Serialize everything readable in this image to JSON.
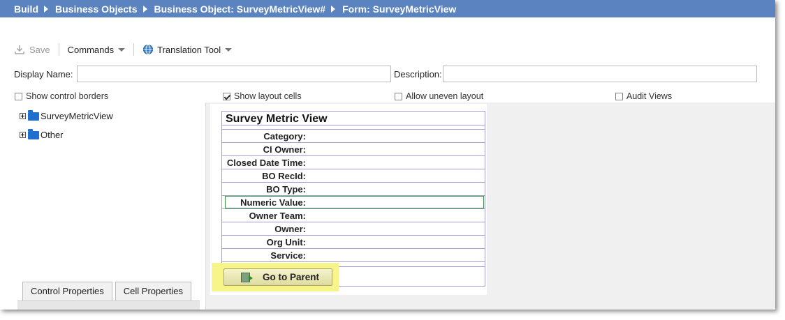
{
  "breadcrumb": [
    "Build",
    "Business Objects",
    "Business Object: SurveyMetricView#",
    "Form: SurveyMetricView"
  ],
  "toolbar": {
    "save_label": "Save",
    "commands_label": "Commands",
    "translation_label": "Translation Tool"
  },
  "fields": {
    "display_name_label": "Display Name:",
    "display_name_value": "",
    "description_label": "Description:",
    "description_value": ""
  },
  "options": {
    "show_control_borders": {
      "label": "Show control borders",
      "checked": false
    },
    "show_layout_cells": {
      "label": "Show layout cells",
      "checked": true
    },
    "allow_uneven_layout": {
      "label": "Allow uneven layout",
      "checked": false
    },
    "audit_views": {
      "label": "Audit Views",
      "checked": false
    }
  },
  "tree": [
    {
      "label": "SurveyMetricView"
    },
    {
      "label": "Other"
    }
  ],
  "tabs": [
    "Control Properties",
    "Cell Properties"
  ],
  "form": {
    "title": "Survey Metric View",
    "rows": [
      "Category:",
      "CI Owner:",
      "Closed Date Time:",
      "BO RecId:",
      "BO Type:",
      "Numeric Value:",
      "Owner Team:",
      "Owner:",
      "Org Unit:",
      "Service:"
    ],
    "selected_row": "Numeric Value:",
    "button_label": "Go to Parent"
  },
  "colors": {
    "breadcrumb_bg": "#5b83c0",
    "grid_line": "#a59bd6",
    "highlight": "#f7f48a",
    "selection_border": "#3a9a3a",
    "folder": "#1f6fcf"
  },
  "icons": {
    "save": "download-icon",
    "translation": "globe-icon",
    "tree_node": "folder-icon",
    "expand": "expand-plus-icon",
    "button": "go-to-parent-icon"
  }
}
